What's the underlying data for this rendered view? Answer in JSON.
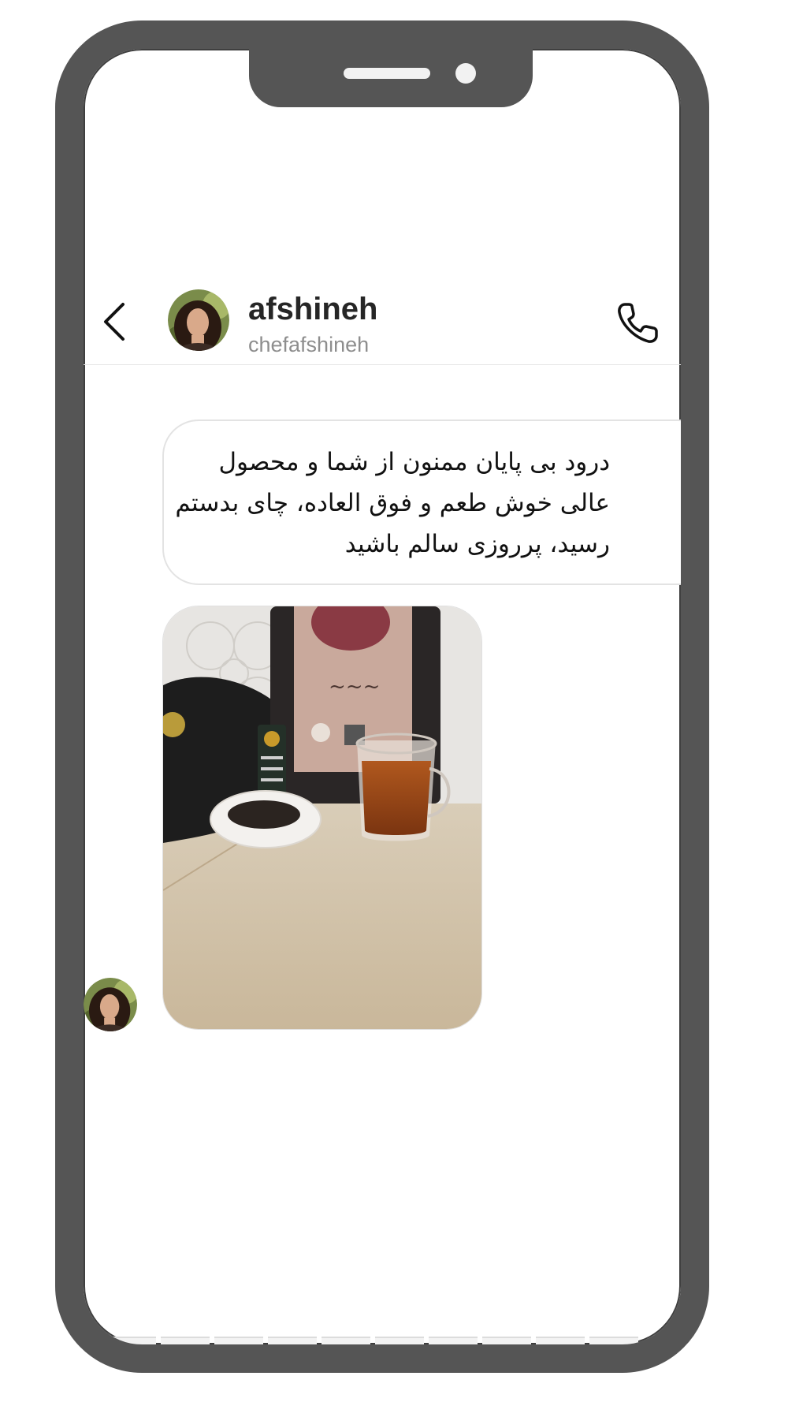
{
  "header": {
    "name": "afshineh",
    "handle": "chefafshineh",
    "back_icon": "chevron-left-icon",
    "call_icon": "phone-icon"
  },
  "message": {
    "text": "درود بی پایان ممنون از شما و محصول عالی خوش طعم و فوق العاده، چای بدستم رسید،  پرروزی  سالم باشید"
  },
  "photo": {
    "icon": "tea-product-photo"
  },
  "colors": {
    "frame": "#555555",
    "bubble_border": "#e3e3e3",
    "name": "#262626",
    "handle": "#8e8e8e"
  },
  "thumbnails": [
    {
      "name": "thumb-1"
    },
    {
      "name": "thumb-2"
    },
    {
      "name": "thumb-3"
    },
    {
      "name": "thumb-4"
    },
    {
      "name": "thumb-5"
    },
    {
      "name": "thumb-6"
    },
    {
      "name": "thumb-7"
    },
    {
      "name": "thumb-8"
    },
    {
      "name": "thumb-9"
    },
    {
      "name": "thumb-10"
    }
  ]
}
